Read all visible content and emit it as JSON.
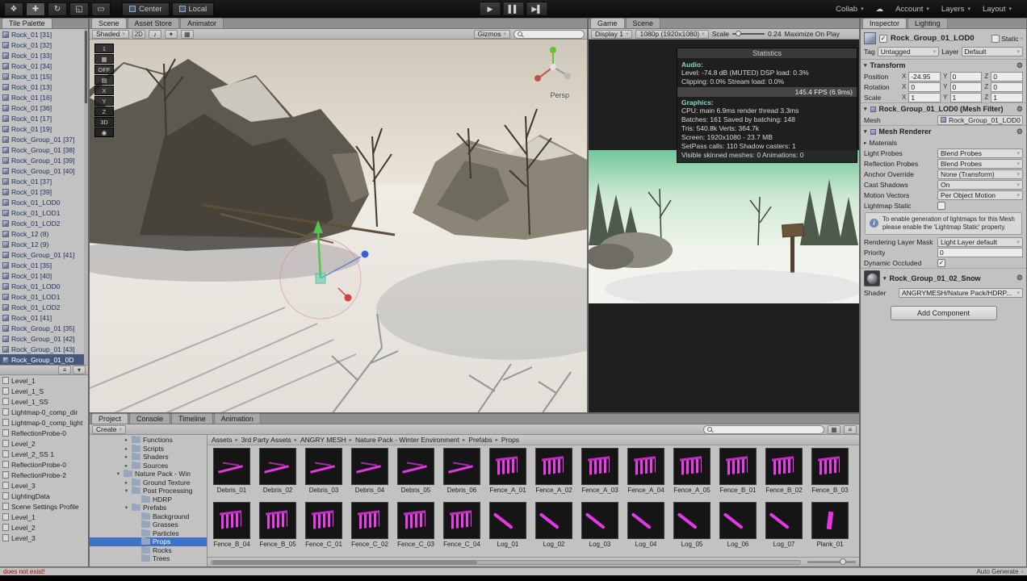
{
  "icons": {
    "hand": "❖",
    "move": "✚",
    "rotate": "↻",
    "scale": "◱",
    "rect": "▭",
    "play": "▶",
    "pause": "▌▌",
    "step": "▶▌",
    "caret": "▾",
    "cloud": "☁",
    "chevron": "›",
    "check": "✓",
    "audio": "♪",
    "fx": "✦",
    "grid": "▦",
    "gear": "⚙",
    "picker": "⊙",
    "arrow_r": "▸",
    "arrow_d": "▾",
    "menu": "≡"
  },
  "colors": {
    "selection_blue": "#3e72c8",
    "prefab_magenta": "#e636e6"
  },
  "topbar": {
    "pivot": "Center",
    "space": "Local",
    "collab": "Collab",
    "account": "Account",
    "layers": "Layers",
    "layout": "Layout"
  },
  "left_panel": {
    "tab": "Tile Palette",
    "items": [
      {
        "label": "Rock_01 [31]"
      },
      {
        "label": "Rock_01 [32]"
      },
      {
        "label": "Rock_01 [33]"
      },
      {
        "label": "Rock_01 [34]"
      },
      {
        "label": "Rock_01 [15]"
      },
      {
        "label": "Rock_01 [13]"
      },
      {
        "label": "Rock_01 [16]"
      },
      {
        "label": "Rock_01 [36]"
      },
      {
        "label": "Rock_01 [17]"
      },
      {
        "label": "Rock_01 [19]"
      },
      {
        "label": "Rock_Group_01 [37]"
      },
      {
        "label": "Rock_Group_01 [38]"
      },
      {
        "label": "Rock_Group_01 [39]"
      },
      {
        "label": "Rock_Group_01 [40]"
      },
      {
        "label": "Rock_01 [37]"
      },
      {
        "label": "Rock_01 [39]"
      },
      {
        "label": "Rock_01_LOD0",
        "indent": true
      },
      {
        "label": "Rock_01_LOD1",
        "indent": true
      },
      {
        "label": "Rock_01_LOD2",
        "indent": true
      },
      {
        "label": "Rock_12 (8)"
      },
      {
        "label": "Rock_12 (9)"
      },
      {
        "label": "Rock_Group_01 [41]"
      },
      {
        "label": "Rock_01 [35]"
      },
      {
        "label": "Rock_01 [40]"
      },
      {
        "label": "Rock_01_LOD0",
        "indent": true
      },
      {
        "label": "Rock_01_LOD1",
        "indent": true
      },
      {
        "label": "Rock_01_LOD2",
        "indent": true
      },
      {
        "label": "Rock_01 [41]"
      },
      {
        "label": "Rock_Group_01 [35]"
      },
      {
        "label": "Rock_Group_01 [42]"
      },
      {
        "label": "Rock_Group_01 [43]"
      },
      {
        "label": "Rock_Group_01_0D",
        "selected": true
      }
    ],
    "lower_items": [
      "Level_1",
      "Level_1_S",
      "Level_1_SS",
      "Lightmap-0_comp_dir",
      "Lightmap-0_comp_light",
      "ReflectionProbe-0",
      "Level_2",
      "Level_2_SS 1",
      "ReflectionProbe-0",
      "ReflectionProbe-2",
      "Level_3",
      "LightingData",
      "Scene Settings Profile",
      "Level_1",
      "Level_2",
      "Level_3"
    ]
  },
  "scene": {
    "tabs": [
      "Scene",
      "Asset Store",
      "Animator"
    ],
    "shading": "Shaded",
    "btn_2d": "2D",
    "gizmos_label": "Gizmos",
    "persp_label": "Persp",
    "overlay_buttons": [
      "1",
      "▦",
      "OFF",
      "▤",
      "X",
      "Y",
      "Z",
      "3D",
      "◉"
    ]
  },
  "game": {
    "tabs": [
      "Game",
      "Scene"
    ],
    "display": "Display 1",
    "resolution": "1080p (1920x1080)",
    "scale_label": "Scale",
    "scale_value": "0.24",
    "maximize_label": "Maximize On Play",
    "stats": {
      "title": "Statistics",
      "audio_header": "Audio:",
      "audio_lines": [
        "Level: -74.8 dB (MUTED)   DSP load: 0.3%",
        "Clipping: 0.0%   Stream load: 0.0%"
      ],
      "fps": "145.4 FPS (6.9ms)",
      "graphics_header": "Graphics:",
      "graphics_lines": [
        "CPU: main 6.9ms   render thread 3.3ms",
        "Batches: 161      Saved by batching: 148",
        "Tris: 540.8k   Verts: 364.7k",
        "Screen: 1920x1080 - 23.7 MB",
        "SetPass calls: 110   Shadow casters: 1",
        "Visible skinned meshes: 0   Animations: 0"
      ]
    }
  },
  "inspector": {
    "tabs": [
      "Inspector",
      "Lighting"
    ],
    "header": {
      "name": "Rock_Group_01_LOD0",
      "static_label": "Static"
    },
    "tag_label": "Tag",
    "tag_value": "Untagged",
    "layer_label": "Layer",
    "layer_value": "Default",
    "axis": {
      "x": "X",
      "y": "Y",
      "z": "Z"
    },
    "transform": {
      "title": "Transform",
      "rows": [
        {
          "label": "Position",
          "x": "-24.95",
          "y": "0",
          "z": "0"
        },
        {
          "label": "Rotation",
          "x": "0",
          "y": "0",
          "z": "0"
        },
        {
          "label": "Scale",
          "x": "1",
          "y": "1",
          "z": "1"
        }
      ]
    },
    "mesh_filter": {
      "title": "Rock_Group_01_LOD0 (Mesh Filter)",
      "mesh_label": "Mesh",
      "mesh_value": "Rock_Group_01_LOD0"
    },
    "renderer": {
      "title": "Mesh Renderer",
      "materials_label": "Materials",
      "rows": [
        {
          "label": "Light Probes",
          "value": "Blend Probes"
        },
        {
          "label": "Reflection Probes",
          "value": "Blend Probes"
        },
        {
          "label": "Anchor Override",
          "value": "None (Transform)"
        },
        {
          "label": "Cast Shadows",
          "value": "On"
        },
        {
          "label": "Motion Vectors",
          "value": "Per Object Motion"
        }
      ],
      "lightmap_static_label": "Lightmap Static",
      "info": "To enable generation of lightmaps for this Mesh please enable the 'Lightmap Static' property.",
      "layer_mask_label": "Rendering Layer Mask",
      "layer_mask_value": "Light Layer default",
      "priority_label": "Priority",
      "priority_value": "0",
      "dynamic_occluded_label": "Dynamic Occluded"
    },
    "material": {
      "name": "Rock_Group_01_02_Snow",
      "shader_label": "Shader",
      "shader_value": "ANGRYMESH/Nature Pack/HDRP..."
    },
    "add_component": "Add Component"
  },
  "project": {
    "tabs": [
      "Project",
      "Console",
      "Timeline",
      "Animation"
    ],
    "create_label": "Create",
    "breadcrumb": [
      "Assets",
      "3rd Party Assets",
      "ANGRY MESH",
      "Nature Pack - Winter Environment",
      "Prefabs",
      "Props"
    ],
    "tree": [
      {
        "label": "Functions",
        "depth": "d2",
        "arrow": "▸"
      },
      {
        "label": "Scripts",
        "depth": "d2",
        "arrow": "▸"
      },
      {
        "label": "Shaders",
        "depth": "d2",
        "arrow": "▸"
      },
      {
        "label": "Sources",
        "depth": "d2",
        "arrow": "▸"
      },
      {
        "label": "Nature Pack - Win",
        "depth": "d1",
        "arrow": "▾"
      },
      {
        "label": "Ground Texture",
        "depth": "d2",
        "arrow": "▸"
      },
      {
        "label": "Post Processing",
        "depth": "d2",
        "arrow": "▾"
      },
      {
        "label": "HDRP",
        "depth": "d3",
        "arrow": ""
      },
      {
        "label": "Prefabs",
        "depth": "d2",
        "arrow": "▾"
      },
      {
        "label": "Background",
        "depth": "d3",
        "arrow": ""
      },
      {
        "label": "Grasses",
        "depth": "d3",
        "arrow": ""
      },
      {
        "label": "Particles",
        "depth": "d3",
        "arrow": ""
      },
      {
        "label": "Props",
        "depth": "d3",
        "arrow": "",
        "selected": true
      },
      {
        "label": "Rocks",
        "depth": "d3",
        "arrow": ""
      },
      {
        "label": "Trees",
        "depth": "d3",
        "arrow": ""
      }
    ],
    "items": [
      {
        "label": "Debris_01",
        "kind": "debris"
      },
      {
        "label": "Debris_02",
        "kind": "debris"
      },
      {
        "label": "Debris_03",
        "kind": "debris"
      },
      {
        "label": "Debris_04",
        "kind": "debris"
      },
      {
        "label": "Debris_05",
        "kind": "debris"
      },
      {
        "label": "Debris_06",
        "kind": "debris"
      },
      {
        "label": "Fence_A_01",
        "kind": "fence"
      },
      {
        "label": "Fence_A_02",
        "kind": "fence"
      },
      {
        "label": "Fence_A_03",
        "kind": "fence"
      },
      {
        "label": "Fence_A_04",
        "kind": "fence"
      },
      {
        "label": "Fence_A_05",
        "kind": "fence"
      },
      {
        "label": "Fence_B_01",
        "kind": "fence"
      },
      {
        "label": "Fence_B_02",
        "kind": "fence"
      },
      {
        "label": "Fence_B_03",
        "kind": "fence"
      },
      {
        "label": "Fence_B_04",
        "kind": "fence"
      },
      {
        "label": "Fence_B_05",
        "kind": "fence"
      },
      {
        "label": "Fence_C_01",
        "kind": "fence"
      },
      {
        "label": "Fence_C_02",
        "kind": "fence"
      },
      {
        "label": "Fence_C_03",
        "kind": "fence"
      },
      {
        "label": "Fence_C_04",
        "kind": "fence"
      },
      {
        "label": "Log_01",
        "kind": "log"
      },
      {
        "label": "Log_02",
        "kind": "log"
      },
      {
        "label": "Log_03",
        "kind": "log"
      },
      {
        "label": "Log_04",
        "kind": "log"
      },
      {
        "label": "Log_05",
        "kind": "log"
      },
      {
        "label": "Log_06",
        "kind": "log"
      },
      {
        "label": "Log_07",
        "kind": "log"
      },
      {
        "label": "Plank_01",
        "kind": "plank"
      }
    ]
  },
  "status": {
    "message": "does not exist!",
    "auto_label": "Auto Generate"
  }
}
